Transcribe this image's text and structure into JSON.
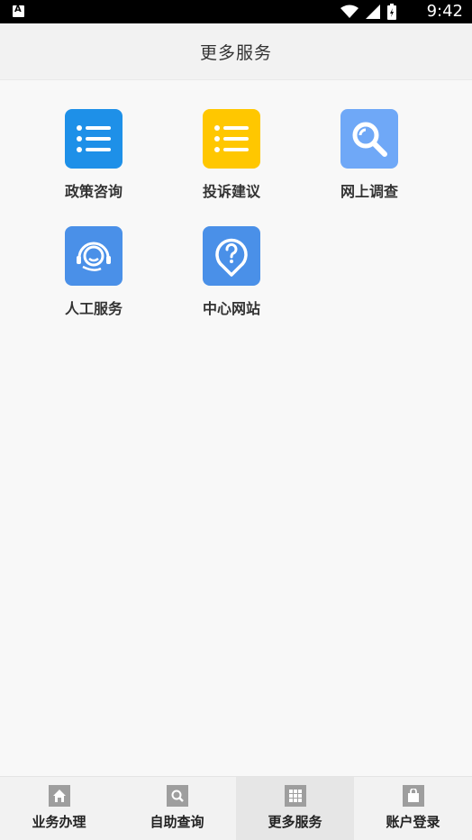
{
  "status_bar": {
    "time": "9:42"
  },
  "header": {
    "title": "更多服务"
  },
  "services": [
    {
      "label": "政策咨询",
      "icon": "list-icon",
      "color": "#1e90e8"
    },
    {
      "label": "投诉建议",
      "icon": "list-icon",
      "color": "#ffc700"
    },
    {
      "label": "网上调查",
      "icon": "search-icon",
      "color": "#6fa8f7"
    },
    {
      "label": "人工服务",
      "icon": "headset-icon",
      "color": "#4a90e8"
    },
    {
      "label": "中心网站",
      "icon": "location-help-icon",
      "color": "#4a90e8"
    }
  ],
  "tabbar": {
    "items": [
      {
        "label": "业务办理",
        "icon": "home-icon"
      },
      {
        "label": "自助查询",
        "icon": "search-icon"
      },
      {
        "label": "更多服务",
        "icon": "grid-icon"
      },
      {
        "label": "账户登录",
        "icon": "bag-icon"
      }
    ],
    "active": "更多服务"
  }
}
